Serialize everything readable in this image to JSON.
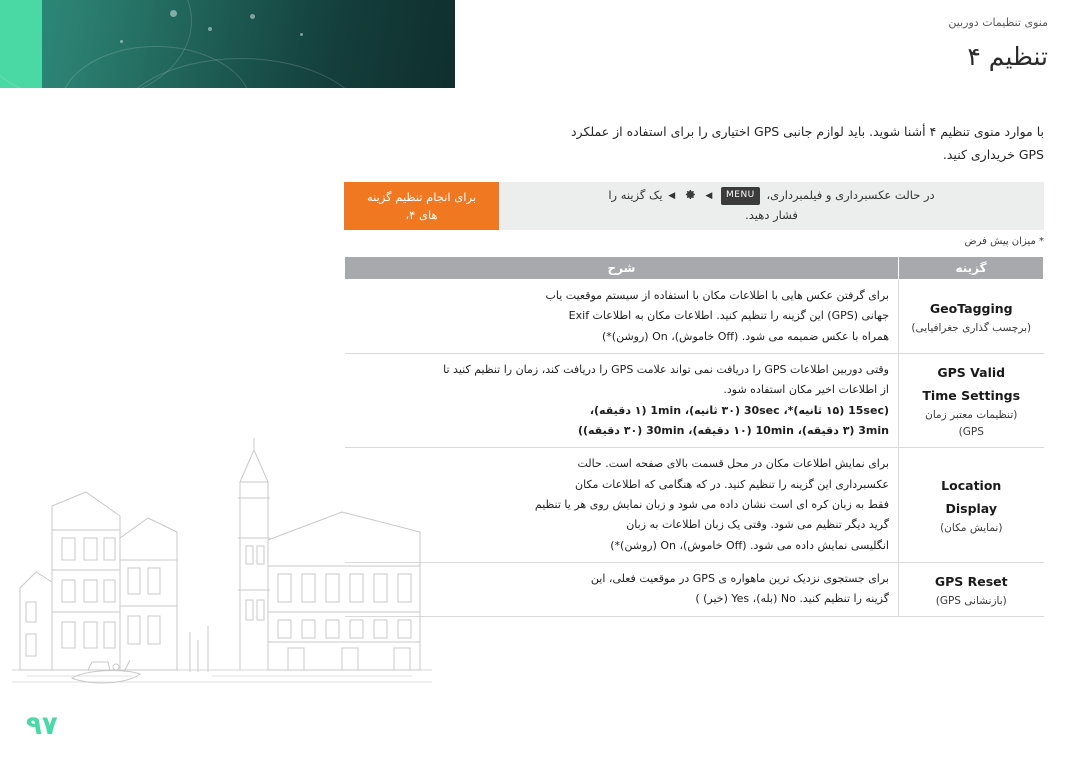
{
  "header": {
    "running_head": "منوی تنظیمات دوربین",
    "chapter_title": "تنظیم ۴"
  },
  "intro": {
    "line1": "با موارد منوی تنظیم ۴ أشنا شوید. باید لوازم جانبی GPS اختیاری را برای استفاده از عملکرد",
    "line2": "GPS خریداری کنید."
  },
  "menu_box": {
    "label_line1": "برای انجام تنظیم گزینه",
    "label_line2": "های ۴،",
    "path_line1_prefix": "در حالت عکسبرداری و فیلمبرداری،",
    "path_menu_button": "MENU",
    "path_arrow1": "◀",
    "path_gear_icon": "gear-icon",
    "path_arrow2": "◀",
    "path_line1_suffix": "یک گزینه را",
    "path_line2": "فشار دهید."
  },
  "note_default": "* میزان پیش فرض",
  "table": {
    "headers": {
      "option": "گزینه",
      "description": "شرح"
    },
    "rows": [
      {
        "name_en": "GeoTagging",
        "name_fa": "(برچسب گذاری جغرافیایی)",
        "desc": [
          "برای گرفتن عکس هایی با اطلاعات مکان با استفاده از سیستم موقعیت یاب",
          "جهانی (GPS) این گزینه را تنظیم کنید. اطلاعات مکان به اطلاعات Exif",
          "همراه با عکس ضمیمه می شود. (Off خاموش)، On (روشن)*)"
        ]
      },
      {
        "name_en_line1": "GPS Valid",
        "name_en_line2": "Time Settings",
        "name_fa_line1": "(تنظیمات معتبر زمان",
        "name_fa_line2": "GPS)",
        "desc": [
          "وقتی دوربین اطلاعات GPS را دریافت نمی تواند علامت GPS را دریافت کند، زمان را تنظیم کنید تا",
          "از اطلاعات اخیر مکان استفاده شود.",
          "(15sec (۱۵ ثانیه)*، 30sec (۳۰ ثانیه)، 1min (۱ دقیقه)،",
          "3min (۳ دقیقه)، 10min (۱۰ دقیقه)،  30min (۳۰ دقیقه))"
        ]
      },
      {
        "name_en_line1": "Location",
        "name_en_line2": "Display",
        "name_fa": "(نمایش مکان)",
        "desc": [
          "برای نمایش اطلاعات مکان در محل قسمت بالای صفحه است. حالت",
          "عکسبرداری این گزینه را تنظیم کنید. در که هنگامی که اطلاعات مکان",
          "فقط به زبان کره ای است نشان داده می شود و زبان نمایش روی هر یا تنظیم",
          "گرید دیگر تنظیم می شود. وقتی یک زبان اطلاعات به زبان",
          "انگلیسی نمایش داده می شود. (Off خاموش)، On (روشن)*)"
        ]
      },
      {
        "name_en": "GPS Reset",
        "name_fa": "(بازنشانی GPS)",
        "desc": [
          "برای جستجوی نزدیک ترین ماهواره ی GPS در موقعیت فعلی، این",
          "گزینه را تنظیم کنید. No (بله)، Yes (خیر) )"
        ]
      }
    ]
  },
  "page_number": "۹۷",
  "colors": {
    "accent_teal": "#4ad9a4",
    "banner_dark": "#143f3c",
    "orange": "#f07820",
    "table_header_gray": "#a7a9ac"
  }
}
